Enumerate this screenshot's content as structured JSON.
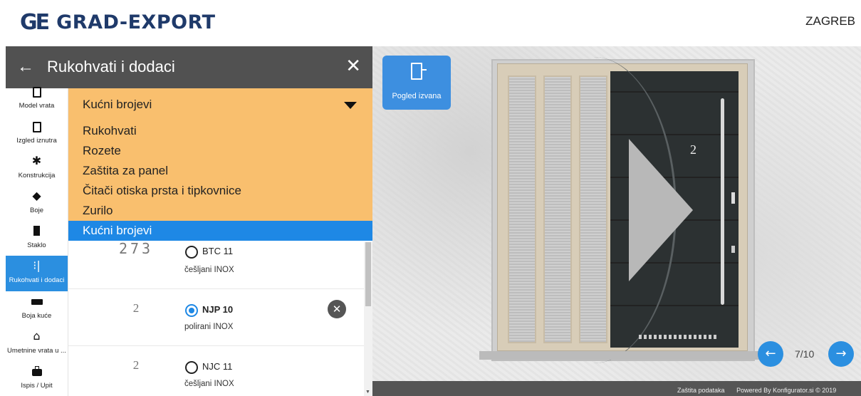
{
  "header": {
    "logo_mark": "GE",
    "logo_text": "GRAD-EXPORT",
    "city": "ZAGREB"
  },
  "panel": {
    "back_icon": "arrow-left-icon",
    "title": "Rukohvati i dodaci",
    "close_icon": "close-icon"
  },
  "sidebar": {
    "items": [
      {
        "label": "Model vrata",
        "icon": "door-outline-icon"
      },
      {
        "label": "Izgled iznutra",
        "icon": "door-exit-icon"
      },
      {
        "label": "Konstrukcija",
        "icon": "gear-icon"
      },
      {
        "label": "Boje",
        "icon": "paint-bucket-icon"
      },
      {
        "label": "Staklo",
        "icon": "glass-panel-icon"
      },
      {
        "label": "Rukohvati i dodaci",
        "icon": "handle-icon"
      },
      {
        "label": "Boja kuće",
        "icon": "house-color-icon"
      },
      {
        "label": "Umetnine vrata u ...",
        "icon": "house-icon"
      },
      {
        "label": "Ispis / Upit",
        "icon": "briefcase-icon"
      }
    ],
    "active_index": 5
  },
  "dropdown": {
    "selected": "Kućni brojevi",
    "options": [
      "Rukohvati",
      "Rozete",
      "Zaštita za panel",
      "Čitači otiska prsta i tipkovnice",
      "Zurilo",
      "Kućni brojevi"
    ]
  },
  "products": [
    {
      "thumb": "273",
      "name": "BTC 11",
      "finish": "češljani INOX",
      "selected": false
    },
    {
      "thumb": "2",
      "name": "NJP 10",
      "finish": "polirani INOX",
      "selected": true
    },
    {
      "thumb": "2",
      "name": "NJC 11",
      "finish": "češljani INOX",
      "selected": false
    }
  ],
  "scene": {
    "view_button_label": "Pogled izvana",
    "house_number": "2",
    "counter": "7/10",
    "footer_privacy": "Zaštita podataka",
    "footer_powered": "Powered By Konfigurator.si © 2019"
  },
  "colors": {
    "accent_blue": "#2b8fe0",
    "dropdown_orange": "#f9bf6e",
    "header_gray": "#515151",
    "brand_navy": "#1f3a6a"
  }
}
